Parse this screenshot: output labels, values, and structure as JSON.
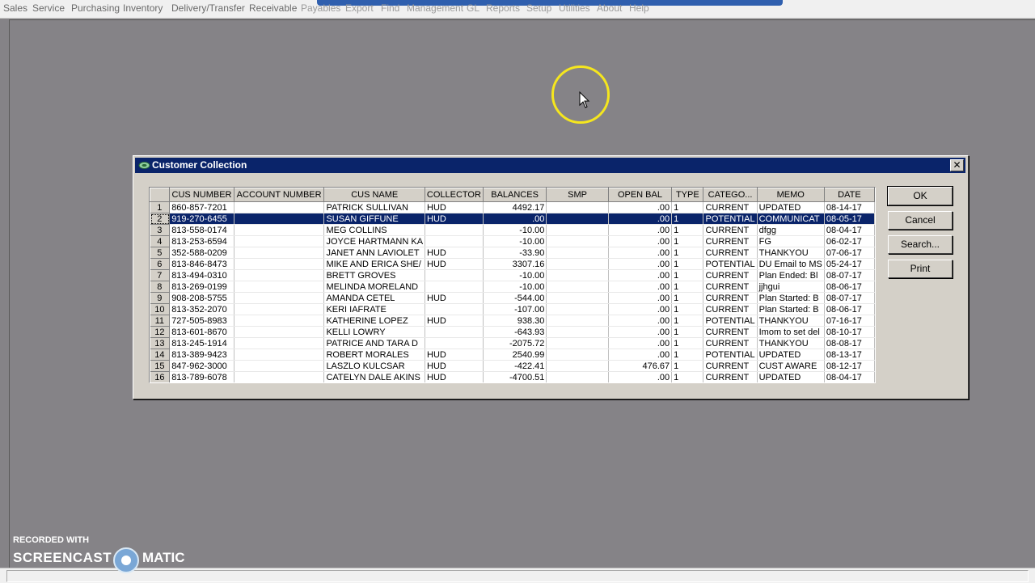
{
  "menu": {
    "items": [
      "Sales",
      "Service",
      "Purchasing",
      "Inventory",
      "Delivery/Transfer",
      "Receivable",
      "Payables",
      "Export",
      "Find",
      "Management",
      "GL",
      "Reports",
      "Setup",
      "Utilities",
      "About",
      "Help"
    ]
  },
  "dialog": {
    "title": "Customer Collection",
    "close_glyph": "✕",
    "buttons": {
      "ok": "OK",
      "cancel": "Cancel",
      "search": "Search...",
      "print": "Print"
    }
  },
  "grid": {
    "columns": [
      "",
      "CUS NUMBER",
      "ACCOUNT NUMBER",
      "CUS NAME",
      "COLLECTOR",
      "BALANCES",
      "SMP",
      "OPEN BAL",
      "TYPE",
      "CATEGO...",
      "MEMO",
      "DATE"
    ],
    "selected_row": 1,
    "rows": [
      [
        "1",
        "860-857-7201",
        "",
        "PATRICK  SULLIVAN",
        "HUD",
        "4492.17",
        "",
        ".00",
        "1",
        "CURRENT",
        "UPDATED",
        "08-14-17"
      ],
      [
        "2",
        "919-270-6455",
        "",
        "SUSAN GIFFUNE",
        "HUD",
        ".00",
        "",
        ".00",
        "1",
        "POTENTIAL",
        "COMMUNICAT",
        "08-05-17"
      ],
      [
        "3",
        "813-558-0174",
        "",
        "MEG  COLLINS",
        "",
        "-10.00",
        "",
        ".00",
        "1",
        "CURRENT",
        "dfgg",
        "08-04-17"
      ],
      [
        "4",
        "813-253-6594",
        "",
        "JOYCE HARTMANN KA",
        "",
        "-10.00",
        "",
        ".00",
        "1",
        "CURRENT",
        "FG",
        "06-02-17"
      ],
      [
        "5",
        "352-588-0209",
        "",
        "JANET ANN LAVIOLET",
        "HUD",
        "-33.90",
        "",
        ".00",
        "1",
        "CURRENT",
        "THANKYOU",
        "07-06-17"
      ],
      [
        "6",
        "813-846-8473",
        "",
        "MIKE AND ERICA SHE/",
        "HUD",
        "3307.16",
        "",
        ".00",
        "1",
        "POTENTIAL",
        "DU Email to MS",
        "05-24-17"
      ],
      [
        "7",
        "813-494-0310",
        "",
        "BRETT  GROVES",
        "",
        "-10.00",
        "",
        ".00",
        "1",
        "CURRENT",
        "Plan Ended: Bl",
        "08-07-17"
      ],
      [
        "8",
        "813-269-0199",
        "",
        "MELINDA  MORELAND",
        "",
        "-10.00",
        "",
        ".00",
        "1",
        "CURRENT",
        "jjhgui",
        "08-06-17"
      ],
      [
        "9",
        "908-208-5755",
        "",
        "AMANDA CETEL",
        "HUD",
        "-544.00",
        "",
        ".00",
        "1",
        "CURRENT",
        "Plan Started: B",
        "08-07-17"
      ],
      [
        "10",
        "813-352-2070",
        "",
        "KERI   IAFRATE",
        "",
        "-107.00",
        "",
        ".00",
        "1",
        "CURRENT",
        "Plan Started: B",
        "08-06-17"
      ],
      [
        "11",
        "727-505-8983",
        "",
        "KATHERINE LOPEZ",
        "HUD",
        "938.30",
        "",
        ".00",
        "1",
        "POTENTIAL",
        "THANKYOU",
        "07-16-17"
      ],
      [
        "12",
        "813-601-8670",
        "",
        "KELLI LOWRY",
        "",
        "-643.93",
        "",
        ".00",
        "1",
        "CURRENT",
        "Imom to set del",
        "08-10-17"
      ],
      [
        "13",
        "813-245-1914",
        "",
        "PATRICE AND TARA D",
        "",
        "-2075.72",
        "",
        ".00",
        "1",
        "CURRENT",
        "THANKYOU",
        "08-08-17"
      ],
      [
        "14",
        "813-389-9423",
        "",
        "ROBERT MORALES",
        "HUD",
        "2540.99",
        "",
        ".00",
        "1",
        "POTENTIAL",
        "UPDATED",
        "08-13-17"
      ],
      [
        "15",
        "847-962-3000",
        "",
        "LASZLO    KULCSAR",
        "HUD",
        "-422.41",
        "",
        "476.67",
        "1",
        "CURRENT",
        "CUST AWARE",
        "08-12-17"
      ],
      [
        "16",
        "813-789-6078",
        "",
        "CATELYN DALE AKINS",
        "HUD",
        "-4700.51",
        "",
        ".00",
        "1",
        "CURRENT",
        "UPDATED",
        "08-04-17"
      ]
    ]
  },
  "watermark": {
    "line1": "RECORDED WITH",
    "line2": "SCREENCAST",
    "line3": "MATIC"
  },
  "colors": {
    "desktop": "#858387",
    "titlebar": "#0a246a",
    "cursor_ring": "#f5e61e"
  }
}
